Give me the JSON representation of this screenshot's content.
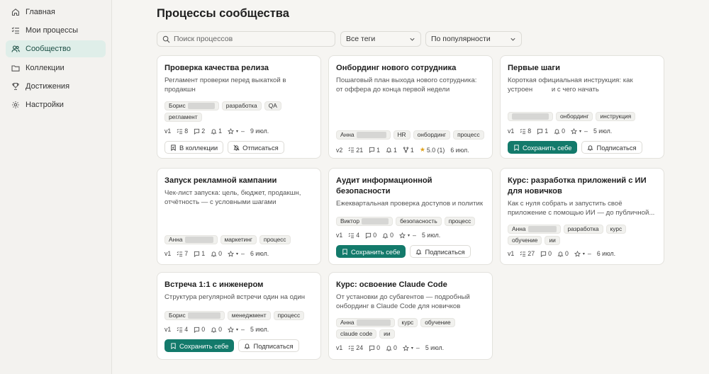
{
  "sidebar": {
    "items": [
      {
        "label": "Главная",
        "icon": "home-icon"
      },
      {
        "label": "Мои процессы",
        "icon": "list-icon"
      },
      {
        "label": "Сообщество",
        "icon": "users-icon",
        "active": true
      },
      {
        "label": "Коллекции",
        "icon": "folder-icon"
      },
      {
        "label": "Достижения",
        "icon": "trophy-icon"
      },
      {
        "label": "Настройки",
        "icon": "gear-icon"
      }
    ]
  },
  "header": {
    "title": "Процессы сообщества",
    "search_placeholder": "Поиск процессов",
    "tags_filter": "Все теги",
    "sort_filter": "По популярности"
  },
  "colors": {
    "accent": "#137a6b",
    "active_nav_bg": "#dfeee9",
    "star": "#e0a21c"
  },
  "cards": [
    {
      "title": "Проверка качества релиза",
      "desc": "Регламент проверки перед выкаткой в продакшн",
      "author": "Борис",
      "tags": [
        "разработка",
        "QA",
        "регламент"
      ],
      "version": "v1",
      "steps": "8",
      "comments": "2",
      "subs": "1",
      "rating": "–",
      "date": "9 июл.",
      "btn1": "В коллекции",
      "btn2": "Отписаться"
    },
    {
      "title": "Онбординг нового сотрудника",
      "desc": "Пошаговый план выхода нового сотрудника: от оффера до конца первой недели",
      "author": "Анна",
      "tags": [
        "HR",
        "онбординг",
        "процесс"
      ],
      "version": "v2",
      "steps": "21",
      "comments": "1",
      "subs": "1",
      "forks": "1",
      "rating": "5.0 (1)",
      "date": "6 июл."
    },
    {
      "title": "Первые шаги",
      "desc": "Короткая официальная инструкция: как устроен          и с чего начать",
      "author": "",
      "tags": [
        "онбординг",
        "инструкция"
      ],
      "version": "v1",
      "steps": "8",
      "comments": "1",
      "subs": "0",
      "rating": "–",
      "date": "5 июл.",
      "btn1": "Сохранить себе",
      "btn2": "Подписаться"
    },
    {
      "title": "Запуск рекламной кампании",
      "desc": "Чек-лист запуска: цель, бюджет, продакшн, отчётность — с условными шагами",
      "author": "Анна",
      "tags": [
        "маркетинг",
        "процесс"
      ],
      "version": "v1",
      "steps": "7",
      "comments": "1",
      "subs": "0",
      "rating": "–",
      "date": "6 июл."
    },
    {
      "title": "Аудит информационной безопасности",
      "desc": "Ежеквартальная проверка доступов и политик",
      "author": "Виктор",
      "tags": [
        "безопасность",
        "процесс"
      ],
      "version": "v1",
      "steps": "4",
      "comments": "0",
      "subs": "0",
      "rating": "–",
      "date": "5 июл.",
      "btn1": "Сохранить себе",
      "btn2": "Подписаться"
    },
    {
      "title": "Курс: разработка приложений с ИИ для новичков",
      "desc": "Как с нуля собрать и запустить своё приложение с помощью ИИ — до публичной...",
      "author": "Анна",
      "tags": [
        "разработка",
        "курс",
        "обучение",
        "ии"
      ],
      "version": "v1",
      "steps": "27",
      "comments": "0",
      "subs": "0",
      "rating": "–",
      "date": "6 июл."
    },
    {
      "title": "Встреча 1:1 с инженером",
      "desc": "Структура регулярной встречи один на один",
      "author": "Борис",
      "tags": [
        "менеджмент",
        "процесс"
      ],
      "version": "v1",
      "steps": "4",
      "comments": "0",
      "subs": "0",
      "rating": "–",
      "date": "5 июл.",
      "btn1": "Сохранить себе",
      "btn2": "Подписаться"
    },
    {
      "title": "Курс: освоение Claude Code",
      "desc": "От установки до субагентов — подробный онбординг в Claude Code для новичков",
      "author": "Анна",
      "tags": [
        "курс",
        "обучение",
        "claude code",
        "ии"
      ],
      "version": "v1",
      "steps": "24",
      "comments": "0",
      "subs": "0",
      "rating": "–",
      "date": "5 июл."
    }
  ]
}
